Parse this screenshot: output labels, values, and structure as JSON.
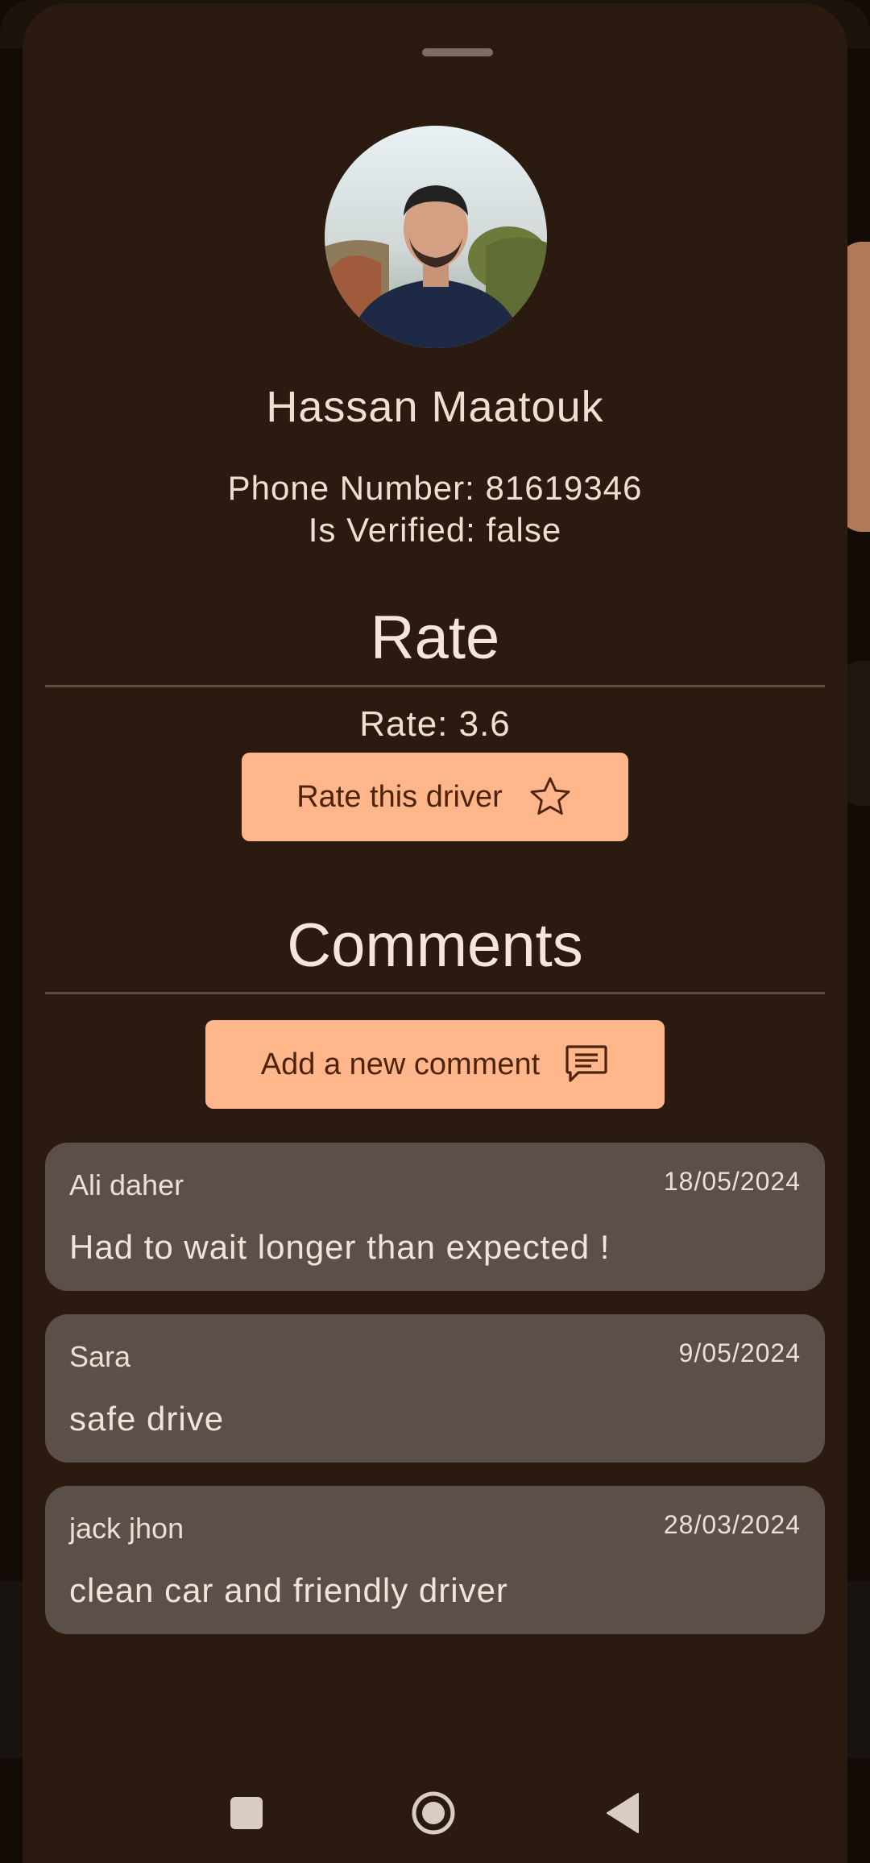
{
  "profile": {
    "name": "Hassan Maatouk",
    "phone": "Phone Number: 81619346",
    "verified": "Is Verified: false"
  },
  "rate_section": {
    "title": "Rate",
    "value": "Rate: 3.6",
    "button_label": "Rate this driver",
    "button_icon": "star-outline-icon"
  },
  "comments_section": {
    "title": "Comments",
    "button_label": "Add a new comment",
    "button_icon": "comment-icon",
    "comments": [
      {
        "author": "Ali daher",
        "date": "18/05/2024",
        "text": "Had to wait longer than expected !"
      },
      {
        "author": "Sara",
        "date": "9/05/2024",
        "text": "safe drive"
      },
      {
        "author": "jack jhon",
        "date": "28/03/2024",
        "text": "clean car and friendly driver"
      }
    ]
  },
  "nav": {
    "recents_icon": "square-icon",
    "home_icon": "circle-icon",
    "back_icon": "triangle-back-icon"
  },
  "colors": {
    "sheet_background": "#2b1a10",
    "button": "#ffb68a",
    "button_text": "#4e230c",
    "card": "#5a4f49",
    "text": "#f1ddd2"
  }
}
